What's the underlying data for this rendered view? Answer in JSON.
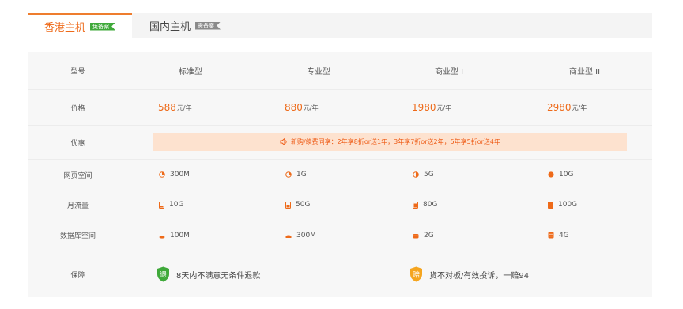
{
  "tabs": [
    {
      "label": "香港主机",
      "tag": "免备案"
    },
    {
      "label": "国内主机",
      "tag": "需备案"
    }
  ],
  "columns": [
    "标准型",
    "专业型",
    "商业型 I",
    "商业型 II"
  ],
  "rows": {
    "model_label": "型号",
    "price_label": "价格",
    "promo_label": "优惠",
    "space_label": "网页空间",
    "traffic_label": "月流量",
    "db_label": "数据库空间",
    "guarantee_label": "保障"
  },
  "prices": [
    {
      "amount": "588",
      "unit": "元/年"
    },
    {
      "amount": "880",
      "unit": "元/年"
    },
    {
      "amount": "1980",
      "unit": "元/年"
    },
    {
      "amount": "2980",
      "unit": "元/年"
    }
  ],
  "promo_text": "新购/续费同享：2年享8折or送1年，3年享7折or送2年，5年享5折or送4年",
  "space": [
    "300M",
    "1G",
    "5G",
    "10G"
  ],
  "traffic": [
    "10G",
    "50G",
    "80G",
    "100G"
  ],
  "database": [
    "100M",
    "300M",
    "2G",
    "4G"
  ],
  "guarantees": [
    {
      "badge": "退",
      "text": "8天内不满意无条件退款"
    },
    {
      "badge": "赔",
      "text": "货不对板/有效投诉，一赔94"
    }
  ],
  "colors": {
    "accent": "#ee6a19",
    "promo_bg": "#fde2cf",
    "green": "#3fa93a",
    "orange": "#f5a51f"
  }
}
